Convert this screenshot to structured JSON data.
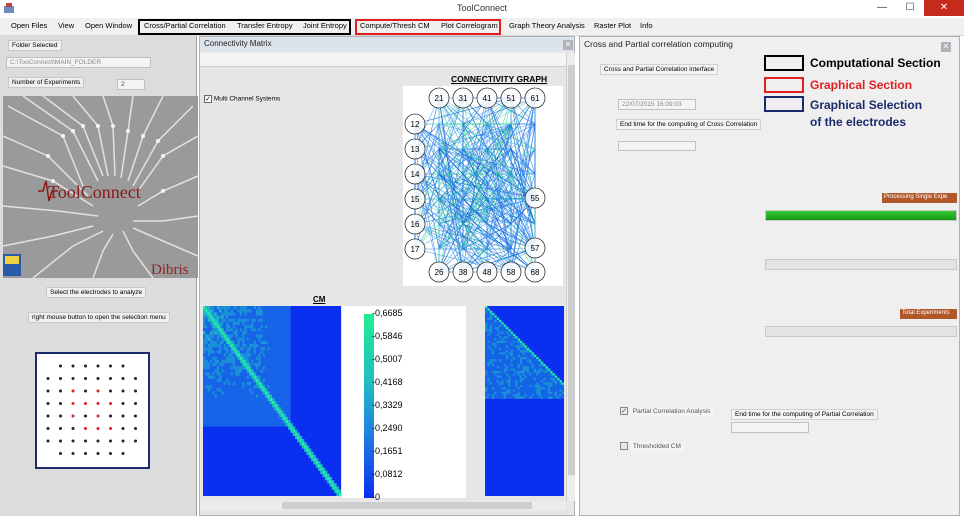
{
  "window": {
    "title": "ToolConnect",
    "min": "—",
    "max": "☐",
    "close": "✕"
  },
  "menu": {
    "items": [
      "Open Files",
      "View",
      "Open Window",
      "Cross/Partial Correlation",
      "Transfer Entropy",
      "Joint Entropy",
      "Compute/Thresh CM",
      "Plot Correlogram",
      "Graph Theory Analysis",
      "Raster Plot",
      "Info"
    ]
  },
  "left": {
    "folder_label": "Folder Selected",
    "folder_value": "C:\\TooConnect\\MAIN_FOLDER",
    "experiments_label": "Number of Experiments",
    "experiments_value": "2",
    "logo_text": "ToolConnect",
    "dibris": "Dibris",
    "select_label": "Select the electrodes to analyze",
    "rightclick_label": "right mouse button to open the selection menu"
  },
  "connectivity": {
    "title": "Connectivity Matrix",
    "checkbox_label": "Multi Channel Systems",
    "graph_title": "CONNECTIVITY GRAPH",
    "top_nodes": [
      "21",
      "31",
      "41",
      "51",
      "61"
    ],
    "left_nodes": [
      "12",
      "13",
      "14",
      "15",
      "16",
      "17"
    ],
    "bottom_nodes": [
      "26",
      "38",
      "48",
      "58",
      "68"
    ],
    "right_nodes": [
      "55",
      "57"
    ],
    "cm_title": "CM",
    "colorbar_ticks": [
      "0,6685",
      "0,5846",
      "0,5007",
      "0,4168",
      "0,3329",
      "0,2490",
      "0,1651",
      "0,0812",
      "0"
    ]
  },
  "cross": {
    "title": "Cross and Partial correlation computing",
    "interface_label": "Cross and Partial Correlation interface",
    "start_time": "22/07/2015 16:09:03",
    "end_cross_label": "End time for the computing of Cross Correlation",
    "processing_label": "Processing Single Expe",
    "total_label": "Total Experiments",
    "partial_checkbox": "Partial Correlation Analysis",
    "end_partial_label": "End time for the computing of Partial Correlation",
    "thresholded_checkbox": "Thresholded CM",
    "progress_single": 1.0,
    "progress_total": 0.0
  },
  "legend": [
    {
      "label": "Computational Section",
      "color": "#000000"
    },
    {
      "label": "Graphical Section",
      "color": "#e02020"
    },
    {
      "label": "Graphical Selection",
      "label2": "of the electrodes",
      "color": "#1a2a6c"
    }
  ]
}
